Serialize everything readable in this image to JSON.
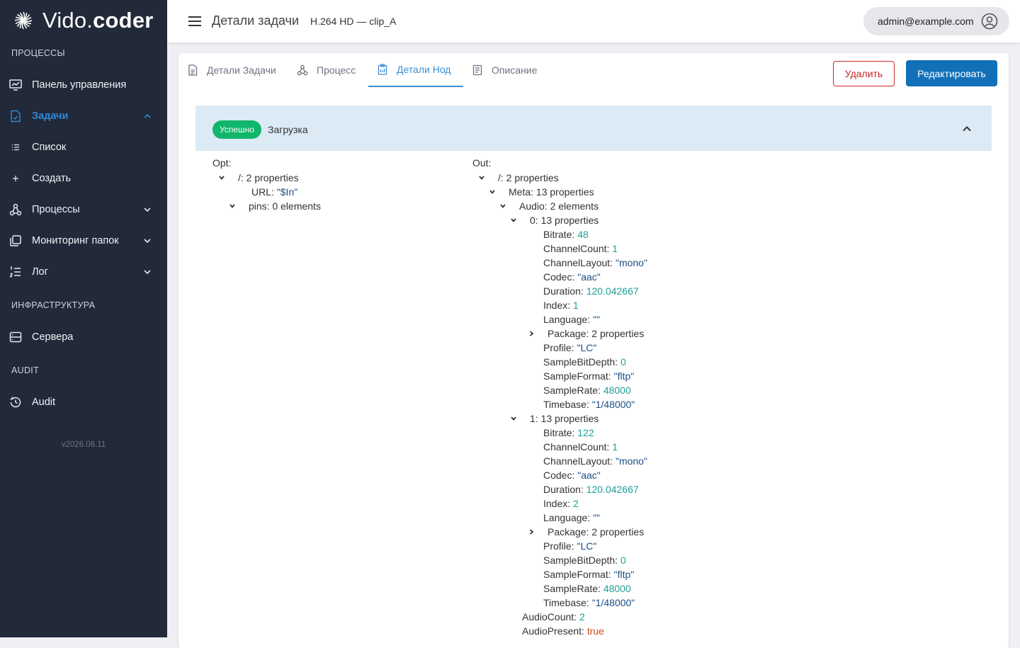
{
  "brand": {
    "prefix": "Vido.",
    "suffix": "coder"
  },
  "sidebar": {
    "sections": [
      "ПРОЦЕССЫ",
      "ИНФРАСТРУКТУРА",
      "AUDIT"
    ],
    "items": [
      {
        "label": "Панель управления",
        "icon": "monitor-chart-icon"
      },
      {
        "label": "Задачи",
        "icon": "task-file-icon"
      },
      {
        "label": "Список",
        "icon": "list-icon"
      },
      {
        "label": "Создать",
        "icon": "plus-icon"
      },
      {
        "label": "Процессы",
        "icon": "process-graph-icon"
      },
      {
        "label": "Мониторинг папок",
        "icon": "copy-folders-icon"
      },
      {
        "label": "Лог",
        "icon": "numbered-list-icon"
      },
      {
        "label": "Сервера",
        "icon": "server-icon"
      },
      {
        "label": "Audit",
        "icon": "history-icon"
      }
    ],
    "version": "v2026.06.11"
  },
  "header": {
    "title": "Детали задачи",
    "subtitle": "H.264 HD — clip_A",
    "user": "admin@example.com"
  },
  "tabs": [
    {
      "label": "Детали Задачи",
      "icon": "document-icon"
    },
    {
      "label": "Процесс",
      "icon": "process-graph-icon"
    },
    {
      "label": "Детали Нод",
      "icon": "clipboard-icon"
    },
    {
      "label": "Описание",
      "icon": "notes-icon"
    }
  ],
  "actions": {
    "delete": "Удалить",
    "edit": "Редактировать"
  },
  "panel": {
    "status": "Успешно",
    "title": "Загрузка"
  },
  "opt": {
    "header": "Opt:",
    "rows": [
      {
        "text": "/: 2 properties",
        "caret": "down"
      },
      {
        "key": "URL:",
        "value": "\"$In\"",
        "type": "str"
      },
      {
        "text": "pins: 0 elements",
        "caret": "down"
      }
    ]
  },
  "out": {
    "header": "Out:",
    "rows": [
      {
        "text": "/: 2 properties",
        "caret": "down"
      },
      {
        "text": "Meta: 13 properties",
        "caret": "down"
      },
      {
        "text": "Audio: 2 elements",
        "caret": "down"
      },
      {
        "text": "0: 13 properties",
        "caret": "down"
      },
      {
        "key": "Bitrate:",
        "value": "48",
        "type": "num"
      },
      {
        "key": "ChannelCount:",
        "value": "1",
        "type": "num"
      },
      {
        "key": "ChannelLayout:",
        "value": "\"mono\"",
        "type": "str"
      },
      {
        "key": "Codec:",
        "value": "\"aac\"",
        "type": "str"
      },
      {
        "key": "Duration:",
        "value": "120.042667",
        "type": "num"
      },
      {
        "key": "Index:",
        "value": "1",
        "type": "num"
      },
      {
        "key": "Language:",
        "value": "\"\"",
        "type": "str"
      },
      {
        "text": "Package: 2 properties",
        "caret": "right"
      },
      {
        "key": "Profile:",
        "value": "\"LC\"",
        "type": "str"
      },
      {
        "key": "SampleBitDepth:",
        "value": "0",
        "type": "num"
      },
      {
        "key": "SampleFormat:",
        "value": "\"fltp\"",
        "type": "str"
      },
      {
        "key": "SampleRate:",
        "value": "48000",
        "type": "num"
      },
      {
        "key": "Timebase:",
        "value": "\"1/48000\"",
        "type": "str"
      },
      {
        "text": "1: 13 properties",
        "caret": "down"
      },
      {
        "key": "Bitrate:",
        "value": "122",
        "type": "num"
      },
      {
        "key": "ChannelCount:",
        "value": "1",
        "type": "num"
      },
      {
        "key": "ChannelLayout:",
        "value": "\"mono\"",
        "type": "str"
      },
      {
        "key": "Codec:",
        "value": "\"aac\"",
        "type": "str"
      },
      {
        "key": "Duration:",
        "value": "120.042667",
        "type": "num"
      },
      {
        "key": "Index:",
        "value": "2",
        "type": "num"
      },
      {
        "key": "Language:",
        "value": "\"\"",
        "type": "str"
      },
      {
        "text": "Package: 2 properties",
        "caret": "right"
      },
      {
        "key": "Profile:",
        "value": "\"LC\"",
        "type": "str"
      },
      {
        "key": "SampleBitDepth:",
        "value": "0",
        "type": "num"
      },
      {
        "key": "SampleFormat:",
        "value": "\"fltp\"",
        "type": "str"
      },
      {
        "key": "SampleRate:",
        "value": "48000",
        "type": "num"
      },
      {
        "key": "Timebase:",
        "value": "\"1/48000\"",
        "type": "str"
      },
      {
        "key": "AudioCount:",
        "value": "2",
        "type": "num"
      },
      {
        "key": "AudioPresent:",
        "value": "true",
        "type": "bool"
      }
    ]
  }
}
